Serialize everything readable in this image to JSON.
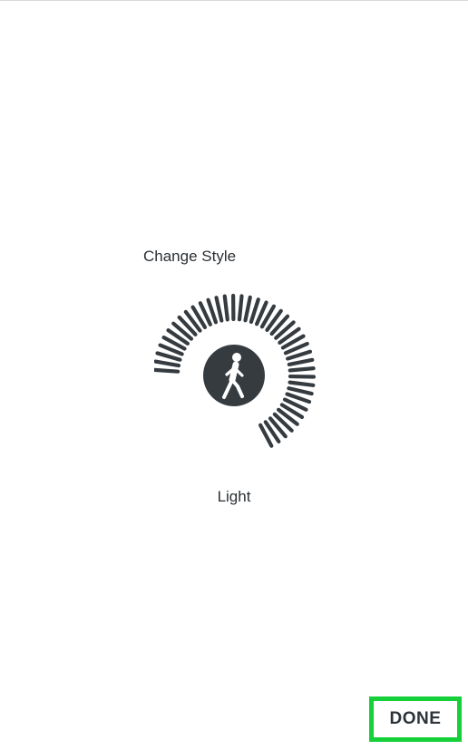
{
  "screen": {
    "title": "Change Style",
    "selected_style": "Light",
    "done_label": "DONE"
  },
  "dial": {
    "center_icon": "walking-person-icon",
    "tick_color": "#363b40",
    "badge_color": "#363b40"
  },
  "colors": {
    "highlight": "#16d03a",
    "text": "#2b3034",
    "background": "#ffffff"
  }
}
